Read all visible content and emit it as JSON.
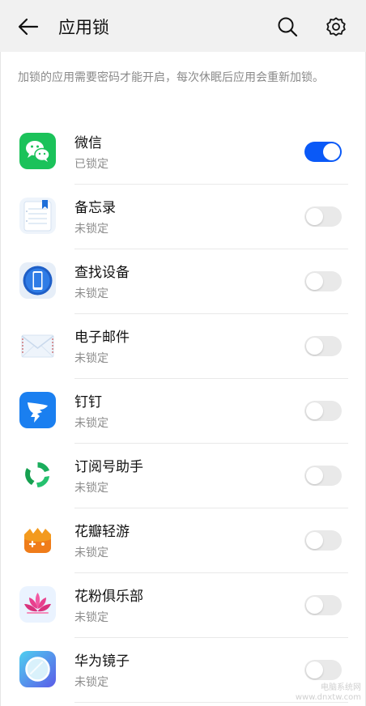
{
  "header": {
    "title": "应用锁",
    "back_icon": "arrow-left-icon",
    "search_icon": "search-icon",
    "settings_icon": "gear-icon"
  },
  "description": "加锁的应用需要密码才能开启，每次休眠后应用会重新加锁。",
  "apps": [
    {
      "name": "微信",
      "status": "已锁定",
      "locked": true,
      "icon": "wechat-icon"
    },
    {
      "name": "备忘录",
      "status": "未锁定",
      "locked": false,
      "icon": "notepad-icon"
    },
    {
      "name": "查找设备",
      "status": "未锁定",
      "locked": false,
      "icon": "find-device-icon"
    },
    {
      "name": "电子邮件",
      "status": "未锁定",
      "locked": false,
      "icon": "email-icon"
    },
    {
      "name": "钉钉",
      "status": "未锁定",
      "locked": false,
      "icon": "dingtalk-icon"
    },
    {
      "name": "订阅号助手",
      "status": "未锁定",
      "locked": false,
      "icon": "subscription-assistant-icon"
    },
    {
      "name": "花瓣轻游",
      "status": "未锁定",
      "locked": false,
      "icon": "petal-games-icon"
    },
    {
      "name": "花粉俱乐部",
      "status": "未锁定",
      "locked": false,
      "icon": "huafen-club-icon"
    },
    {
      "name": "华为镜子",
      "status": "未锁定",
      "locked": false,
      "icon": "huawei-mirror-icon"
    }
  ],
  "colors": {
    "accent": "#0a59f7",
    "toggle_off": "#e9e9e9",
    "appbar_bg": "#f1f1f1"
  },
  "watermark": {
    "line1": "电脑系统网",
    "line2": "www.dnxtw.com"
  }
}
